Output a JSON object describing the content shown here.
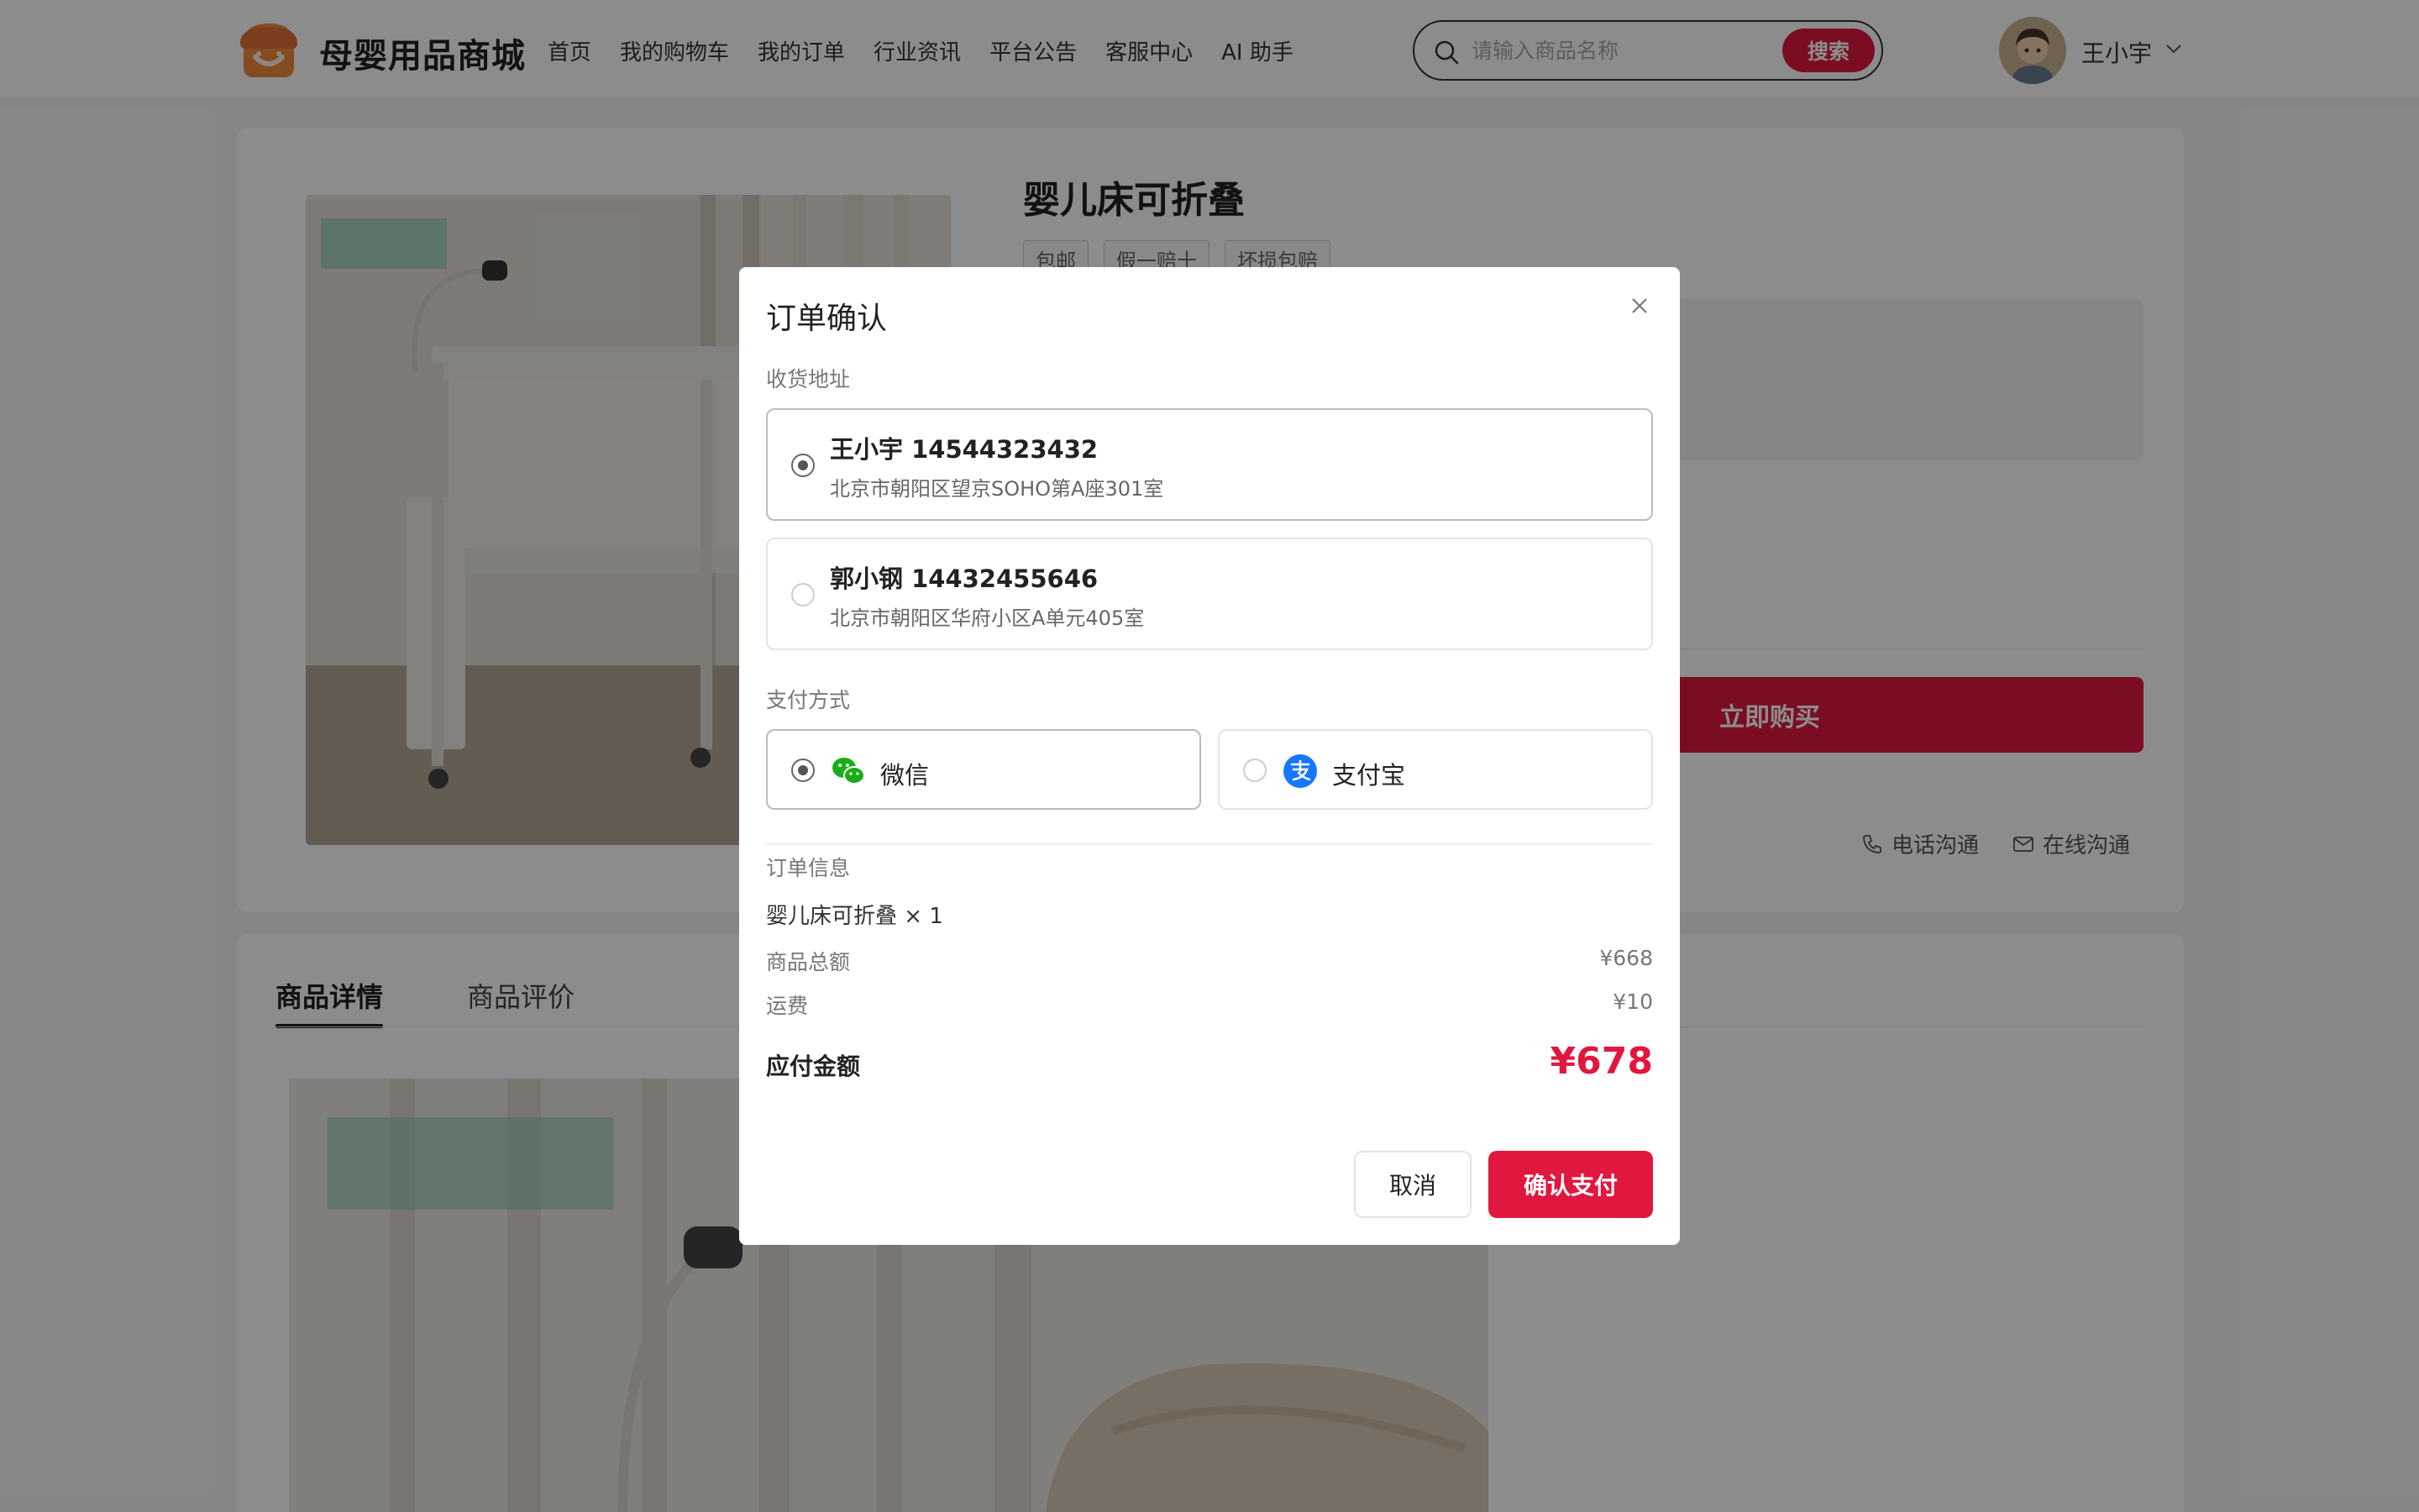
{
  "header": {
    "brand": "母婴用品商城",
    "nav": [
      "首页",
      "我的购物车",
      "我的订单",
      "行业资讯",
      "平台公告",
      "客服中心",
      "AI 助手"
    ],
    "search_placeholder": "请输入商品名称",
    "search_button": "搜索",
    "username": "王小宇"
  },
  "product": {
    "title": "婴儿床可折叠",
    "tags": [
      "包邮",
      "假一赔十",
      "坏损包赔"
    ],
    "buy_button": "立即购买",
    "contact_phone": "电话沟通",
    "contact_online": "在线沟通"
  },
  "detail_tabs": [
    "商品详情",
    "商品评价"
  ],
  "modal": {
    "title": "订单确认",
    "address_label": "收货地址",
    "addresses": [
      {
        "name": "王小宇 14544323432",
        "line": "北京市朝阳区望京SOHO第A座301室",
        "selected": true
      },
      {
        "name": "郭小钢 14432455646",
        "line": "北京市朝阳区华府小区A单元405室",
        "selected": false
      }
    ],
    "payment_label": "支付方式",
    "payments": [
      {
        "label": "微信",
        "icon": "wechat-icon",
        "selected": true
      },
      {
        "label": "支付宝",
        "icon": "alipay-icon",
        "selected": false
      }
    ],
    "order_info_label": "订单信息",
    "order_item": "婴儿床可折叠 × 1",
    "subtotal_label": "商品总额",
    "subtotal_value": "¥668",
    "shipping_label": "运费",
    "shipping_value": "¥10",
    "total_label": "应付金额",
    "total_value": "¥678",
    "cancel_button": "取消",
    "confirm_button": "确认支付"
  },
  "colors": {
    "accent": "#e0183f",
    "wechat": "#1aad19",
    "alipay": "#1677ff"
  }
}
